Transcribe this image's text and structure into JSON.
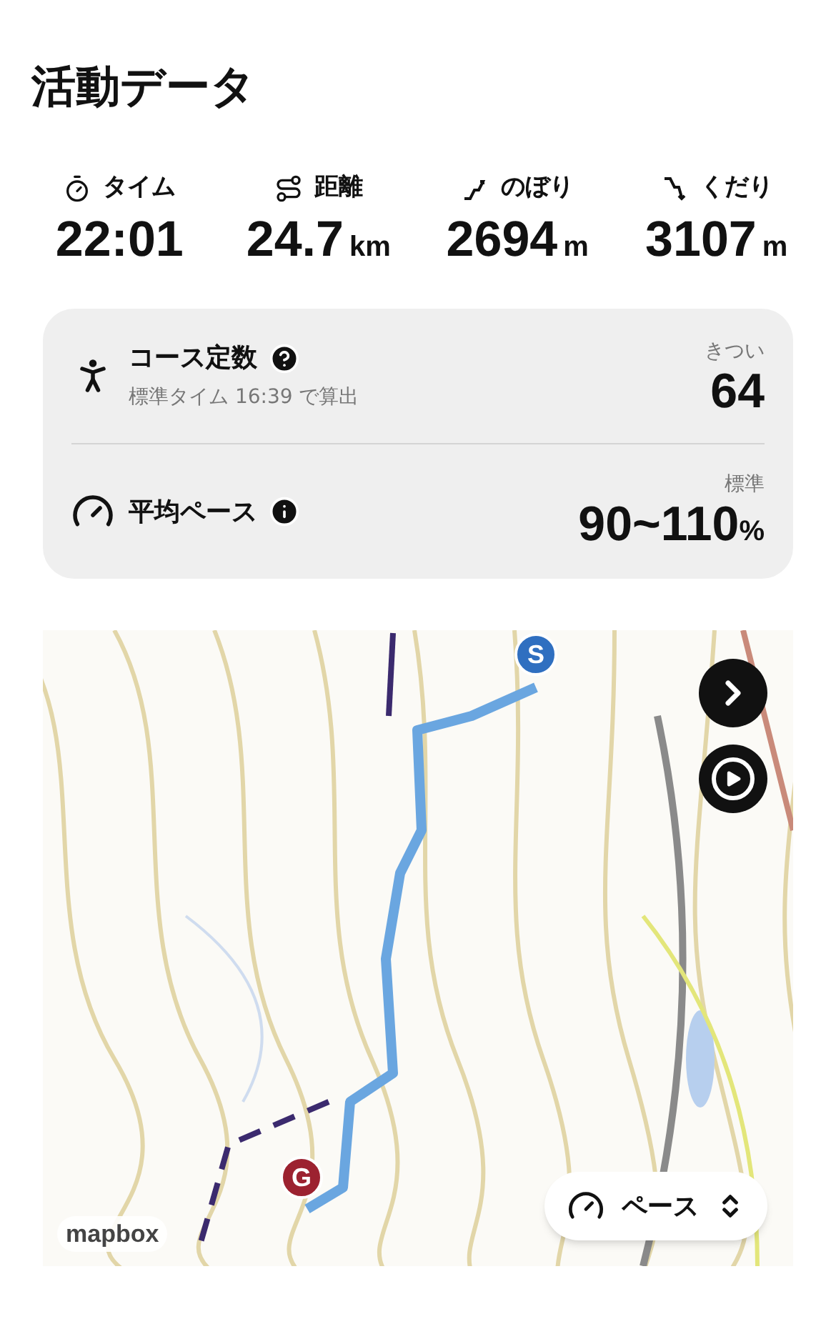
{
  "title": "活動データ",
  "stats": [
    {
      "kind": "time",
      "label": "タイム",
      "value": "22:01"
    },
    {
      "kind": "distance",
      "label": "距離",
      "value": "24.7",
      "unit": "km"
    },
    {
      "kind": "ascent",
      "label": "のぼり",
      "value": "2694",
      "unit": "m"
    },
    {
      "kind": "descent",
      "label": "くだり",
      "value": "3107",
      "unit": "m"
    }
  ],
  "summary": [
    {
      "kind": "course",
      "label": "コース定数",
      "badge": {
        "kind": "help"
      },
      "note": "標準タイム 16:39 で算出",
      "rating": "きつい",
      "value": "64"
    },
    {
      "kind": "pace",
      "label": "平均ペース",
      "badge": {
        "kind": "info"
      },
      "rating": "標準",
      "value": "90~110",
      "unit": "%"
    }
  ],
  "map": {
    "start_marker": "S",
    "goal_marker": "G",
    "attribution": "mapbox",
    "mode_button": "ペース"
  }
}
